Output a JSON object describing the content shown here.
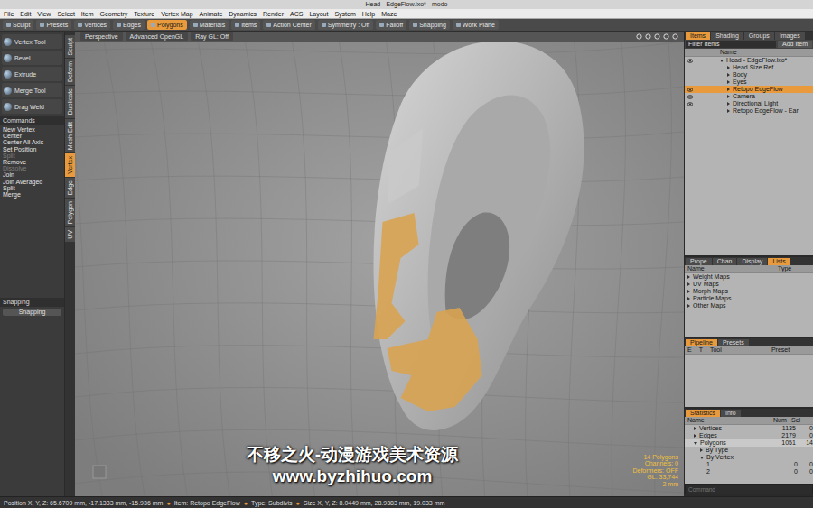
{
  "window": {
    "title": "Head - EdgeFlow.lxo* - modo"
  },
  "menu": [
    "File",
    "Edit",
    "View",
    "Select",
    "Item",
    "Geometry",
    "Texture",
    "Vertex Map",
    "Animate",
    "Dynamics",
    "Render",
    "ACS",
    "Layout",
    "System",
    "Help",
    "Maze"
  ],
  "toolbar": [
    {
      "label": "Sculpt",
      "selected": false
    },
    {
      "label": "Presets",
      "selected": false
    },
    {
      "label": "Vertices",
      "selected": false
    },
    {
      "label": "Edges",
      "selected": false
    },
    {
      "label": "Polygons",
      "selected": true
    },
    {
      "label": "Materials",
      "selected": false
    },
    {
      "label": "Items",
      "selected": false
    },
    {
      "label": "Action Center",
      "selected": false
    },
    {
      "label": "Symmetry : Off",
      "selected": false
    },
    {
      "label": "Falloff",
      "selected": false
    },
    {
      "label": "Snapping",
      "selected": false
    },
    {
      "label": "Work Plane",
      "selected": false
    }
  ],
  "tools": [
    "Vertex Tool",
    "Bevel",
    "Extrude",
    "Merge Tool",
    "Drag Weld"
  ],
  "commands": {
    "title": "Commands",
    "items": [
      {
        "label": "New Vertex",
        "disabled": false
      },
      {
        "label": "Center",
        "disabled": false
      },
      {
        "label": "Center All Axis",
        "disabled": false
      },
      {
        "label": "Set Position",
        "disabled": false
      },
      {
        "label": "Split",
        "disabled": true
      },
      {
        "label": "Remove",
        "disabled": false
      },
      {
        "label": "Dissolve",
        "disabled": true
      },
      {
        "label": "Join",
        "disabled": false
      },
      {
        "label": "Join Averaged",
        "disabled": false
      },
      {
        "label": "Split",
        "disabled": false
      },
      {
        "label": "Merge",
        "disabled": false
      }
    ]
  },
  "vertical_tabs": [
    {
      "label": "Sculpt",
      "selected": false
    },
    {
      "label": "Deform",
      "selected": false
    },
    {
      "label": "Duplicate",
      "selected": false
    },
    {
      "label": "Mesh Edit",
      "selected": false
    },
    {
      "label": "Vertex",
      "selected": true
    },
    {
      "label": "Edge",
      "selected": false
    },
    {
      "label": "Polygon",
      "selected": false
    },
    {
      "label": "UV",
      "selected": false
    }
  ],
  "snapping": {
    "title": "Snapping",
    "button": "Snapping"
  },
  "viewport": {
    "tabs": [
      "Perspective",
      "Advanced OpenGL",
      "Ray GL: Off"
    ],
    "info": [
      "14 Polygons",
      "Channels: 0",
      "Deformers: OFF",
      "GL: 33,744",
      "2 mm"
    ]
  },
  "watermark": {
    "text": "不移之火-动漫游戏美术资源",
    "url": "www.byzhihuo.com"
  },
  "items_panel": {
    "tabs": [
      {
        "label": "Items",
        "selected": true
      },
      {
        "label": "Shading",
        "selected": false
      },
      {
        "label": "Groups",
        "selected": false
      },
      {
        "label": "Images",
        "selected": false
      }
    ],
    "filter": "Filter Items",
    "add": "Add Item",
    "column": "Name",
    "tree": [
      {
        "label": "Head - EdgeFlow.lxo*",
        "depth": 0,
        "visible": true,
        "selected": false
      },
      {
        "label": "Head Size Ref",
        "depth": 1,
        "visible": false,
        "selected": false
      },
      {
        "label": "Body",
        "depth": 1,
        "visible": false,
        "selected": false
      },
      {
        "label": "Eyes",
        "depth": 1,
        "visible": false,
        "selected": false
      },
      {
        "label": "Retopo EdgeFlow",
        "depth": 1,
        "visible": true,
        "selected": true
      },
      {
        "label": "Camera",
        "depth": 1,
        "visible": true,
        "selected": false
      },
      {
        "label": "Directional Light",
        "depth": 1,
        "visible": true,
        "selected": false
      },
      {
        "label": "Retopo EdgeFlow - Ear",
        "depth": 1,
        "visible": false,
        "selected": false
      }
    ]
  },
  "lists_panel": {
    "tabs": [
      {
        "label": "Prope",
        "selected": false
      },
      {
        "label": "Chan",
        "selected": false
      },
      {
        "label": "Display",
        "selected": false
      },
      {
        "label": "Lists",
        "selected": true
      }
    ],
    "columns": [
      "Name",
      "Type"
    ],
    "rows": [
      {
        "label": "Weight Maps",
        "expanded": false
      },
      {
        "label": "UV Maps",
        "expanded": false
      },
      {
        "label": "Morph Maps",
        "expanded": false
      },
      {
        "label": "Particle Maps",
        "expanded": false
      },
      {
        "label": "Other Maps",
        "expanded": false
      }
    ]
  },
  "pipeline_panel": {
    "tabs": [
      {
        "label": "Pipeline",
        "selected": true
      },
      {
        "label": "Presets",
        "selected": false
      }
    ],
    "columns": [
      "E",
      "T",
      "Tool",
      "Preset"
    ]
  },
  "statistics_panel": {
    "tabs": [
      {
        "label": "Statistics",
        "selected": true
      },
      {
        "label": "Info",
        "selected": false
      }
    ],
    "columns": [
      "Name",
      "Num",
      "Sel"
    ],
    "rows": [
      {
        "label": "Vertices",
        "num": "1135",
        "sel": "0",
        "depth": 0,
        "expanded": false,
        "selected": false
      },
      {
        "label": "Edges",
        "num": "2179",
        "sel": "0",
        "depth": 0,
        "expanded": false,
        "selected": false
      },
      {
        "label": "Polygons",
        "num": "1051",
        "sel": "14",
        "depth": 0,
        "expanded": true,
        "selected": true
      },
      {
        "label": "By Type",
        "num": "",
        "sel": "",
        "depth": 1,
        "expanded": false,
        "selected": false
      },
      {
        "label": "By Vertex",
        "num": "",
        "sel": "",
        "depth": 1,
        "expanded": true,
        "selected": false
      },
      {
        "label": "1",
        "num": "0",
        "sel": "0",
        "depth": 2,
        "expanded": false,
        "selected": false
      },
      {
        "label": "2",
        "num": "0",
        "sel": "0",
        "depth": 2,
        "expanded": false,
        "selected": false
      }
    ],
    "command_placeholder": "Command"
  },
  "status_bar": {
    "separator": "●",
    "segments": [
      "Position X, Y, Z: 65.6709 mm, -17.1333 mm, -15.936 mm",
      "Item: Retopo EdgeFlow",
      "Type: Subdivis",
      "Size X, Y, Z: 8.0449 mm, 28.9383 mm, 19.033 mm"
    ]
  }
}
